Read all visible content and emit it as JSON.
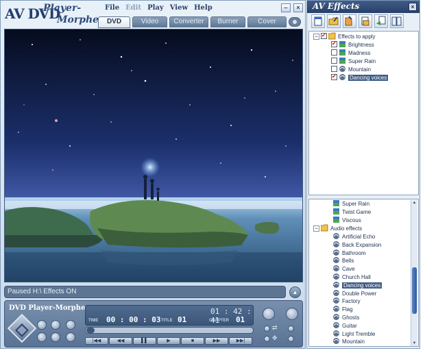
{
  "player": {
    "logo": {
      "av": "AV DVD",
      "player": "Player-",
      "morpher": "Morpher"
    },
    "menu": [
      {
        "label": "File",
        "disabled": false
      },
      {
        "label": "Edit",
        "disabled": true
      },
      {
        "label": "Play",
        "disabled": false
      },
      {
        "label": "View",
        "disabled": false
      },
      {
        "label": "Help",
        "disabled": false
      }
    ],
    "tabs": [
      "DVD",
      "Video",
      "Converter",
      "Burner",
      "Cover"
    ],
    "active_tab": "DVD",
    "status_text": "Paused H:\\  Effects ON",
    "brand": "DVD Player-Morpher",
    "lcd": {
      "clock": "01 : 42 : 41",
      "time_label": "TIME",
      "time_value": "00 : 00 : 03",
      "title_label": "TITLE",
      "title_value": "01",
      "chapter_label": "CHAPTER",
      "chapter_value": "01"
    },
    "transport_icons": [
      "rewind-to-start",
      "rewind",
      "pause",
      "play",
      "stop",
      "fast-forward",
      "skip-to-end"
    ]
  },
  "effects": {
    "title": "AV Effects",
    "close_glyph": "×",
    "toolbar_icons": [
      "new-icon",
      "open-icon",
      "save-icon",
      "export-icon",
      "apply-icon",
      "library-icon"
    ],
    "top_tree": {
      "root": {
        "label": "Effects to apply",
        "checked": true
      },
      "items": [
        {
          "label": "Brightness",
          "checked": true,
          "icon": "image-effect-icon",
          "selected": false
        },
        {
          "label": "Madness",
          "checked": false,
          "icon": "image-effect-icon",
          "selected": false
        },
        {
          "label": "Super Rain",
          "checked": false,
          "icon": "image-effect-icon",
          "selected": false
        },
        {
          "label": "Mountain",
          "checked": false,
          "icon": "audio-effect-icon",
          "selected": false
        },
        {
          "label": "Dancing voices",
          "checked": true,
          "icon": "audio-effect-icon",
          "selected": true
        }
      ]
    },
    "bottom_tree": {
      "video_tail": [
        {
          "label": "Super Rain",
          "icon": "image-effect-icon"
        },
        {
          "label": "Twist Game",
          "icon": "image-effect-icon"
        },
        {
          "label": "Viscous",
          "icon": "image-effect-icon"
        }
      ],
      "audio_group": "Audio effects",
      "audio_items": [
        {
          "label": "Artificial Echo",
          "selected": false
        },
        {
          "label": "Back Expansion",
          "selected": false
        },
        {
          "label": "Bathroom",
          "selected": false
        },
        {
          "label": "Bells",
          "selected": false
        },
        {
          "label": "Cave",
          "selected": false
        },
        {
          "label": "Church Hall",
          "selected": false
        },
        {
          "label": "Dancing voices",
          "selected": true
        },
        {
          "label": "Double Power",
          "selected": false
        },
        {
          "label": "Factory",
          "selected": false
        },
        {
          "label": "Flag",
          "selected": false
        },
        {
          "label": "Ghosts",
          "selected": false
        },
        {
          "label": "Guitar",
          "selected": false
        },
        {
          "label": "Light Tremble",
          "selected": false
        },
        {
          "label": "Mountain",
          "selected": false
        }
      ]
    }
  }
}
